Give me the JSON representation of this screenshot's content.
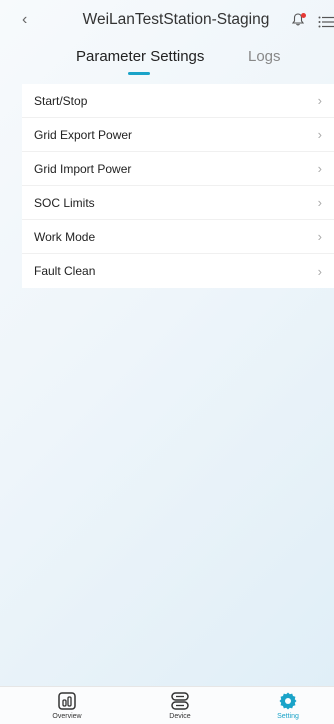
{
  "header": {
    "title": "WeiLanTestStation-Staging",
    "back_icon": "chevron-left-icon",
    "notification_icon": "bell-icon",
    "menu_icon": "list-menu-icon"
  },
  "tabs": [
    {
      "label": "Parameter Settings",
      "active": true
    },
    {
      "label": "Logs",
      "active": false
    }
  ],
  "settings_list": [
    {
      "label": "Start/Stop"
    },
    {
      "label": "Grid Export Power"
    },
    {
      "label": "Grid Import Power"
    },
    {
      "label": "SOC Limits"
    },
    {
      "label": "Work Mode"
    },
    {
      "label": "Fault Clean"
    }
  ],
  "bottom_nav": [
    {
      "label": "Overview",
      "icon": "overview-icon",
      "active": false
    },
    {
      "label": "Device",
      "icon": "device-icon",
      "active": false
    },
    {
      "label": "Setting",
      "icon": "gear-icon",
      "active": true
    }
  ],
  "colors": {
    "accent": "#1aa3c8",
    "notification_dot": "#e53935"
  }
}
